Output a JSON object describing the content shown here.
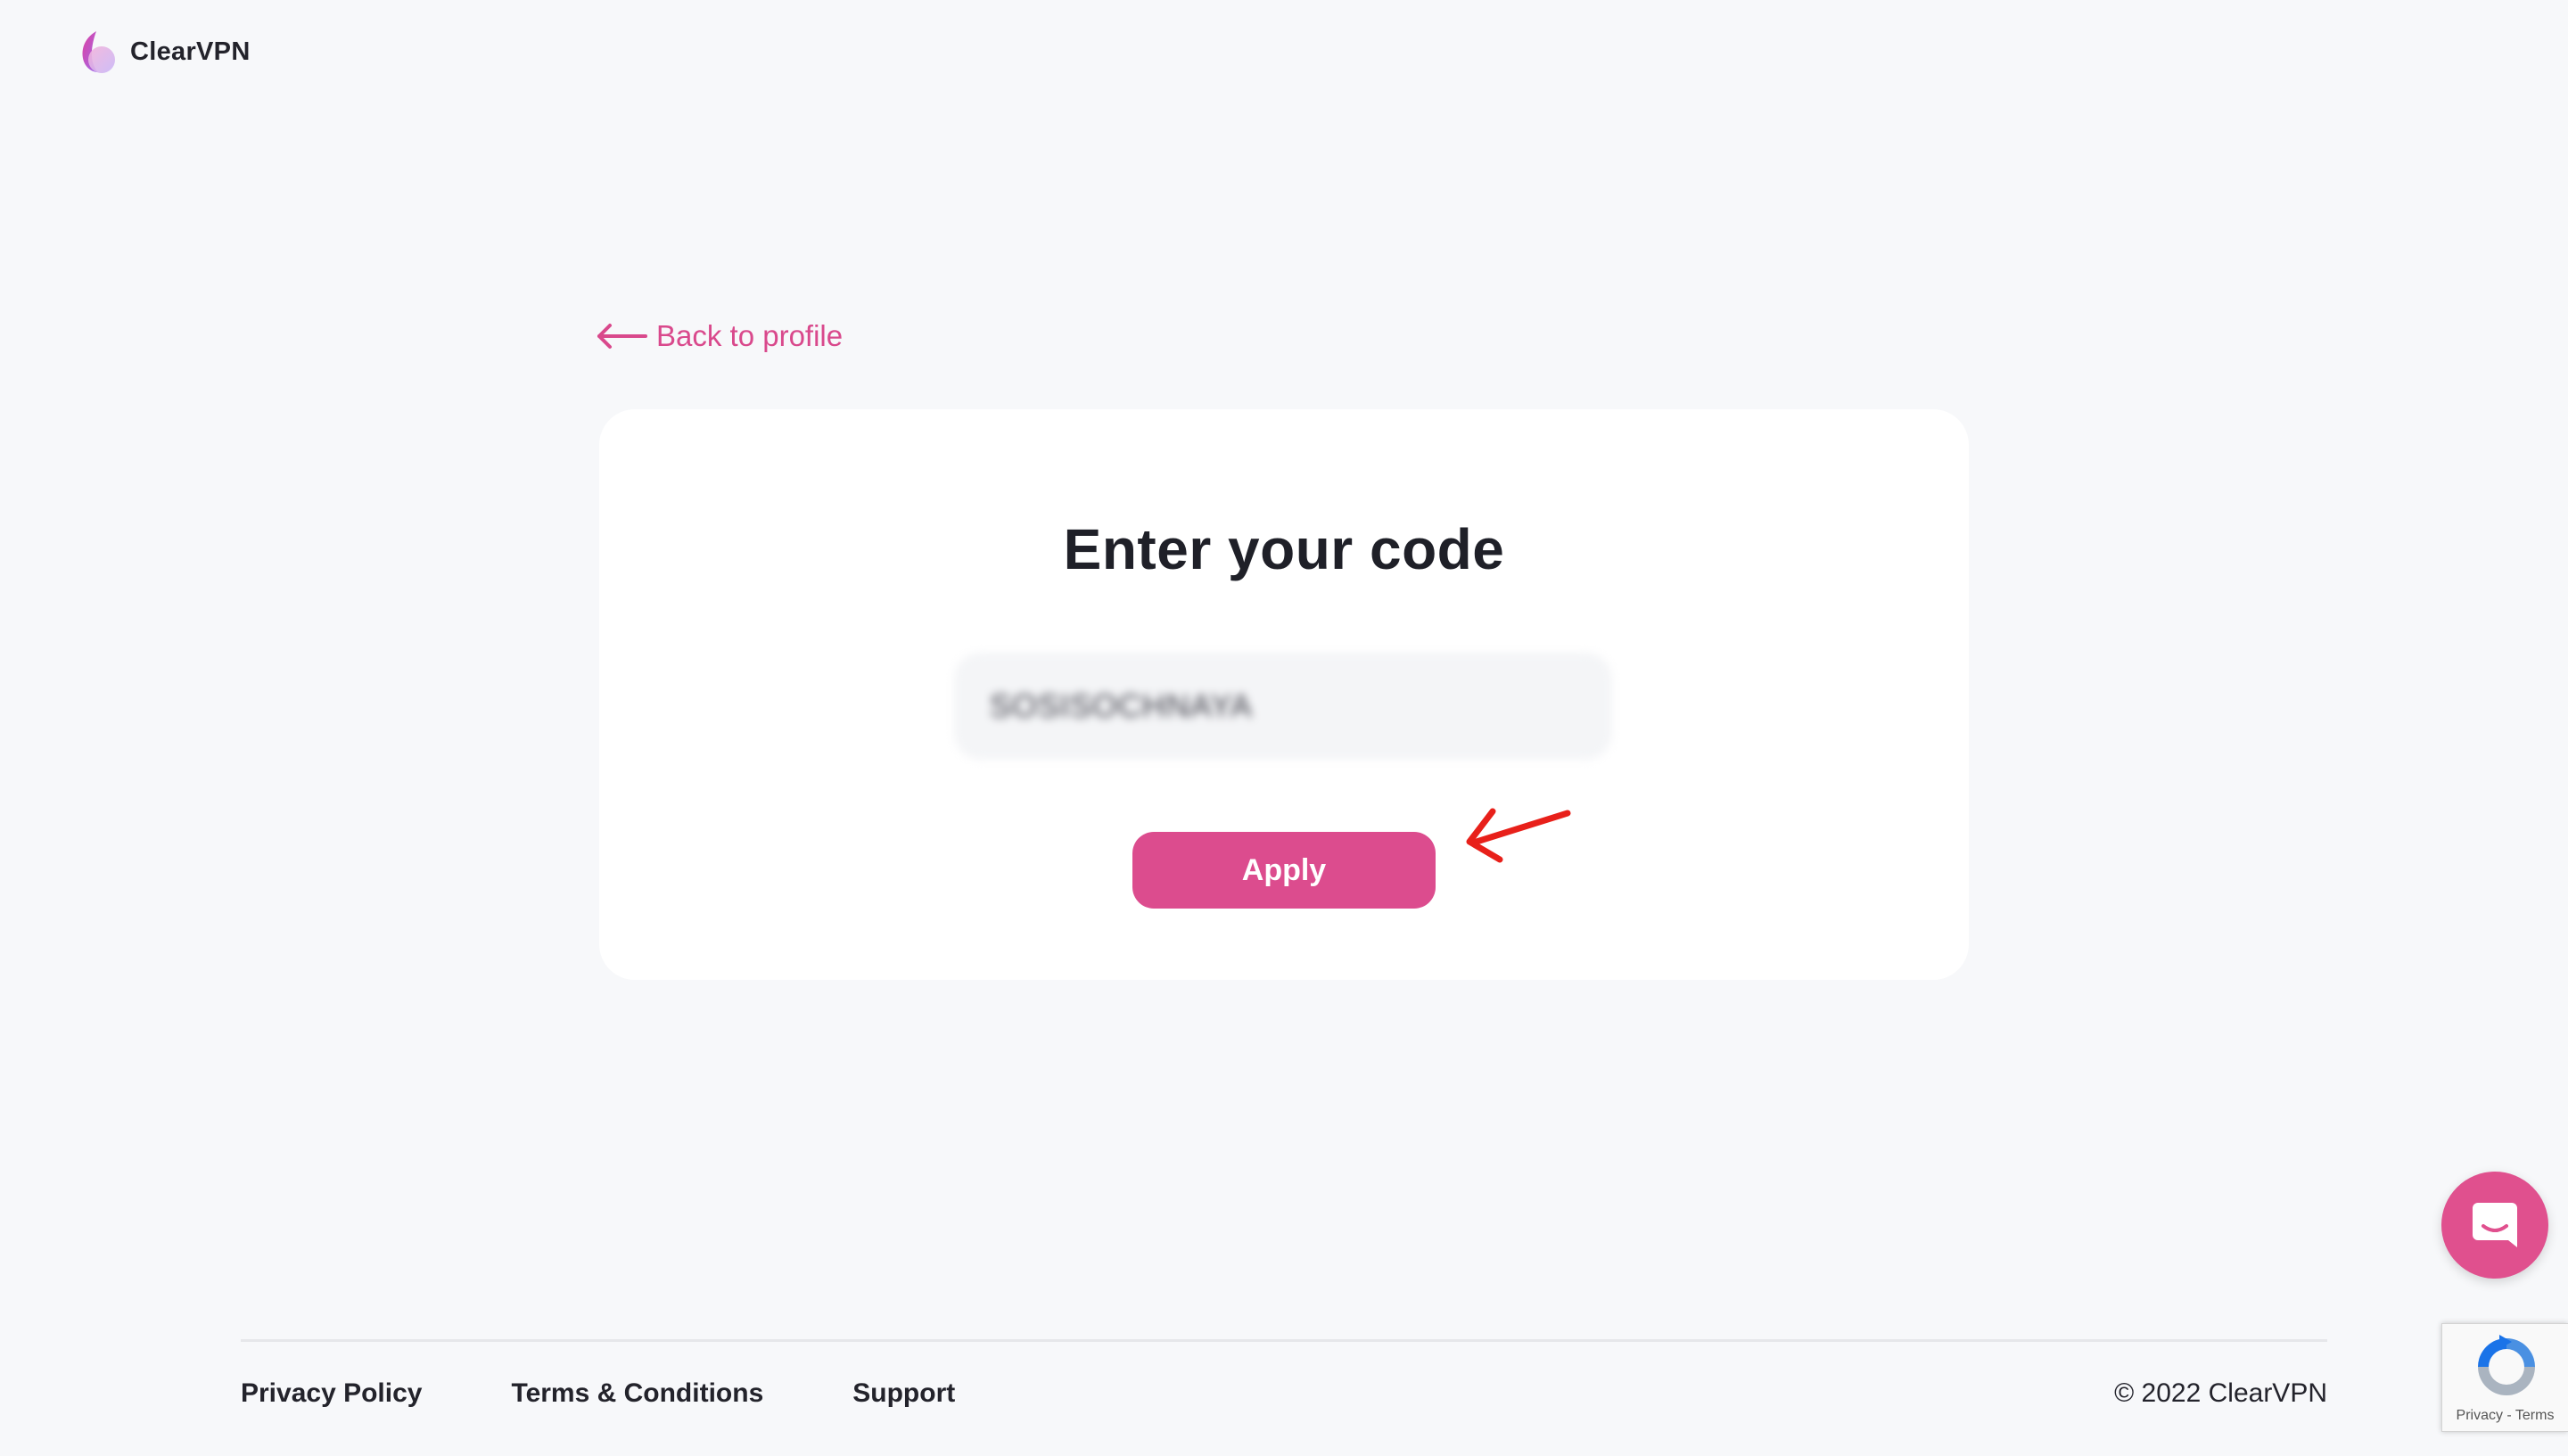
{
  "brand": {
    "name": "ClearVPN",
    "accent_color": "#dc4c8e"
  },
  "nav": {
    "back_label": "Back to profile",
    "back_icon": "arrow-left-icon"
  },
  "card": {
    "title": "Enter your code",
    "code_value": "SOSISOCHNAYA",
    "apply_label": "Apply"
  },
  "annotation": {
    "icon": "red-arrow-annotation",
    "color": "#e8201a"
  },
  "footer": {
    "links": [
      "Privacy Policy",
      "Terms & Conditions",
      "Support"
    ],
    "copyright": "© 2022 ClearVPN"
  },
  "chat": {
    "icon": "chat-bubble-icon",
    "color": "#e0508e"
  },
  "recaptcha": {
    "privacy_label": "Privacy",
    "separator": " - ",
    "terms_label": "Terms"
  }
}
